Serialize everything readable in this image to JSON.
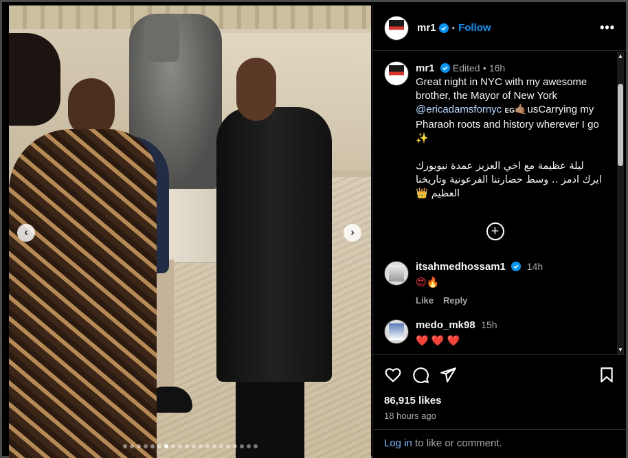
{
  "post": {
    "username": "mr1",
    "follow_label": "Follow",
    "separator": "•",
    "more_label": "•••",
    "caption": {
      "edited_label": "Edited",
      "time": "16h",
      "text_part1": "Great night in NYC with my awesome brother, the Mayor of New York ",
      "mention": "@ericadamsfornyc",
      "flag_text": "EG",
      "hand": "🤙🏽",
      "text_part2": "usCarrying my Pharaoh roots and history wherever I go ",
      "sparkle": "✨",
      "arabic_line1": "ليلة عظيمة مع اخي العزيز عمدة نيويورك",
      "arabic_line2": "ايرك ادمز .. وسط حضارتنا الفرعونية وتاريخنا",
      "arabic_line3": "العظيم 👑"
    },
    "load_more_label": "+",
    "comments": [
      {
        "username": "itsahmedhossam1",
        "time": "14h",
        "text": "😍🔥",
        "like_label": "Like",
        "reply_label": "Reply"
      },
      {
        "username": "medo_mk98",
        "time": "15h",
        "text": "❤️ ❤️ ❤️"
      }
    ],
    "likes": "86,915 likes",
    "posted_ago": "18 hours ago",
    "login_link": "Log in",
    "login_suffix": " to like or comment."
  },
  "carousel": {
    "prev_label": "‹",
    "next_label": "›",
    "dot_count": 20,
    "active_index": 6
  },
  "icons": {
    "verified": "verified-badge-icon",
    "like": "heart-icon",
    "comment": "comment-bubble-icon",
    "share": "paper-plane-icon",
    "save": "bookmark-icon",
    "more": "more-options-icon"
  },
  "colors": {
    "accent": "#0095f6",
    "link": "#b3dbff",
    "muted": "#a8a8a8",
    "background": "#000000"
  }
}
